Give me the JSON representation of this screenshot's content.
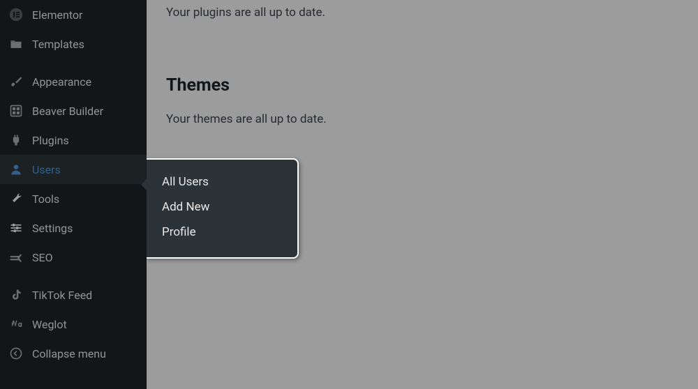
{
  "sidebar": {
    "items": [
      {
        "label": "Elementor",
        "icon": "elementor-icon"
      },
      {
        "label": "Templates",
        "icon": "folder-icon"
      },
      {
        "label": "Appearance",
        "icon": "paintbrush-icon"
      },
      {
        "label": "Beaver Builder",
        "icon": "dashboard-icon"
      },
      {
        "label": "Plugins",
        "icon": "plug-icon"
      },
      {
        "label": "Users",
        "icon": "person-icon"
      },
      {
        "label": "Tools",
        "icon": "wrench-icon"
      },
      {
        "label": "Settings",
        "icon": "sliders-icon"
      },
      {
        "label": "SEO",
        "icon": "seo-icon"
      },
      {
        "label": "TikTok Feed",
        "icon": "tiktok-icon"
      },
      {
        "label": "Weglot",
        "icon": "weglot-icon"
      },
      {
        "label": "Collapse menu",
        "icon": "collapse-icon"
      }
    ]
  },
  "submenu": {
    "items": [
      {
        "label": "All Users"
      },
      {
        "label": "Add New"
      },
      {
        "label": "Profile"
      }
    ]
  },
  "content": {
    "plugins_status": "Your plugins are all up to date.",
    "themes_heading": "Themes",
    "themes_status": "Your themes are all up to date."
  }
}
